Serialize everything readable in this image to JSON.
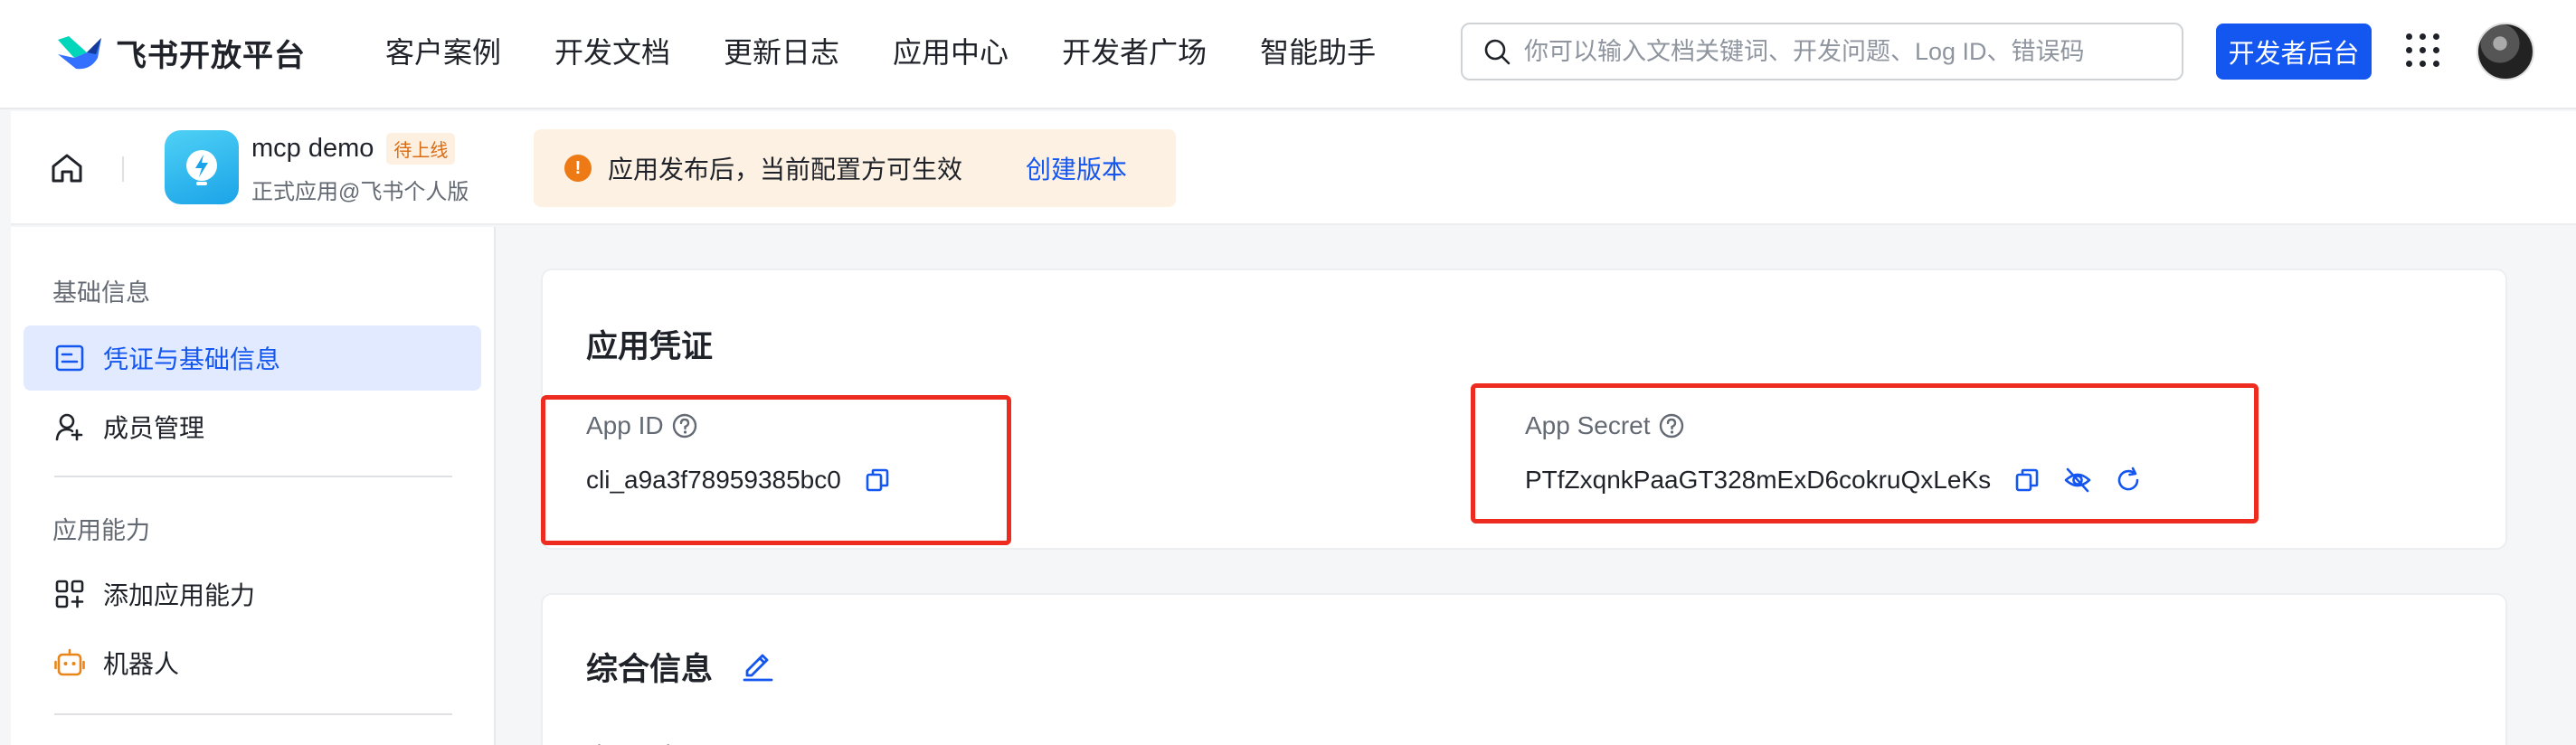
{
  "brand": {
    "name": "飞书开放平台"
  },
  "nav": {
    "links": [
      "客户案例",
      "开发文档",
      "更新日志",
      "应用中心",
      "开发者广场",
      "智能助手"
    ]
  },
  "search": {
    "placeholder": "你可以输入文档关键词、开发问题、Log ID、错误码"
  },
  "header": {
    "console_button": "开发者后台"
  },
  "app": {
    "name": "mcp demo",
    "status_badge": "待上线",
    "subtitle": "正式应用@飞书个人版"
  },
  "notice": {
    "text": "应用发布后，当前配置方可生效",
    "link": "创建版本"
  },
  "sidebar": {
    "group1": "基础信息",
    "items1": [
      {
        "label": "凭证与基础信息",
        "icon": "credential-icon",
        "active": true
      },
      {
        "label": "成员管理",
        "icon": "member-icon",
        "active": false
      }
    ],
    "group2": "应用能力",
    "items2": [
      {
        "label": "添加应用能力",
        "icon": "add-capability-icon",
        "active": false
      },
      {
        "label": "机器人",
        "icon": "robot-icon",
        "active": false
      }
    ]
  },
  "credentials": {
    "title": "应用凭证",
    "app_id_label": "App ID",
    "app_id": "cli_a9a3f78959385bc0",
    "app_secret_label": "App Secret",
    "app_secret": "PTfZxqnkPaaGT328mExD6cokruQxLeKs"
  },
  "general": {
    "title": "综合信息",
    "first_field_label": "应用图标"
  },
  "colors": {
    "accent": "#1456f0",
    "highlight_box": "#ee2b1f",
    "warning": "#ed7a15",
    "badge_text": "#d76b13"
  }
}
